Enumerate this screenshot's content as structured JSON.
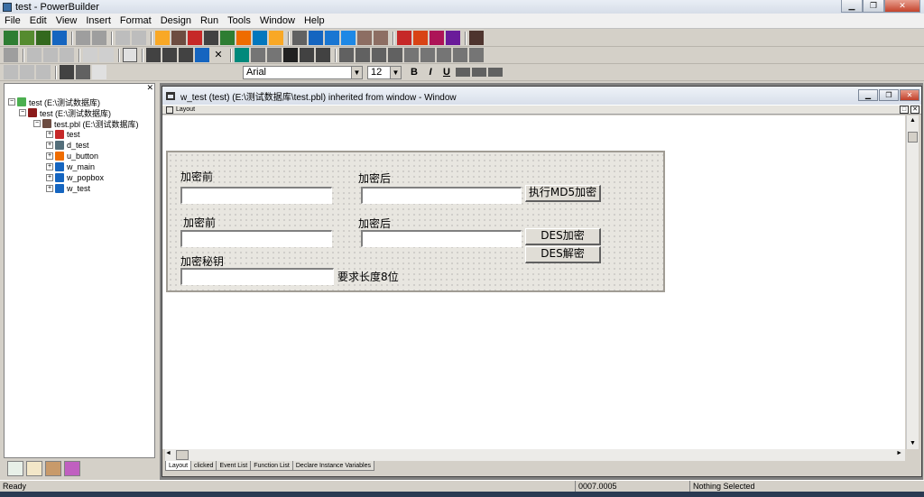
{
  "app": {
    "title": "test - PowerBuilder"
  },
  "menu": [
    "File",
    "Edit",
    "View",
    "Insert",
    "Format",
    "Design",
    "Run",
    "Tools",
    "Window",
    "Help"
  ],
  "format_toolbar": {
    "font": "Arial",
    "size": "12",
    "bold": "B",
    "italic": "I",
    "underline": "U"
  },
  "tree": {
    "nodes": [
      {
        "label": "test (E:\\测试数据库)",
        "depth": 0
      },
      {
        "label": "test (E:\\测试数据库)",
        "depth": 1
      },
      {
        "label": "test.pbl (E:\\测试数据库)",
        "depth": 2
      },
      {
        "label": "test",
        "depth": 3
      },
      {
        "label": "d_test",
        "depth": 3
      },
      {
        "label": "u_button",
        "depth": 3
      },
      {
        "label": "w_main",
        "depth": 3
      },
      {
        "label": "w_popbox",
        "depth": 3
      },
      {
        "label": "w_test",
        "depth": 3
      }
    ]
  },
  "child_window": {
    "title": "w_test (test) (E:\\测试数据库\\test.pbl) inherited from window - Window",
    "layout_label": "Layout"
  },
  "form": {
    "label_before_1": "加密前",
    "label_after_1": "加密后",
    "btn_md5": "执行MD5加密",
    "label_before_2": "加密前",
    "label_after_2": "加密后",
    "btn_des_encrypt": "DES加密",
    "btn_des_decrypt": "DES解密",
    "label_key": "加密秘钥",
    "label_key_hint": "要求长度8位"
  },
  "bottom_tabs": [
    "Layout",
    "clicked",
    "Event List",
    "Function List",
    "Declare Instance Variables"
  ],
  "status": {
    "ready": "Ready",
    "position": "0007.0005",
    "selection": "Nothing Selected"
  }
}
